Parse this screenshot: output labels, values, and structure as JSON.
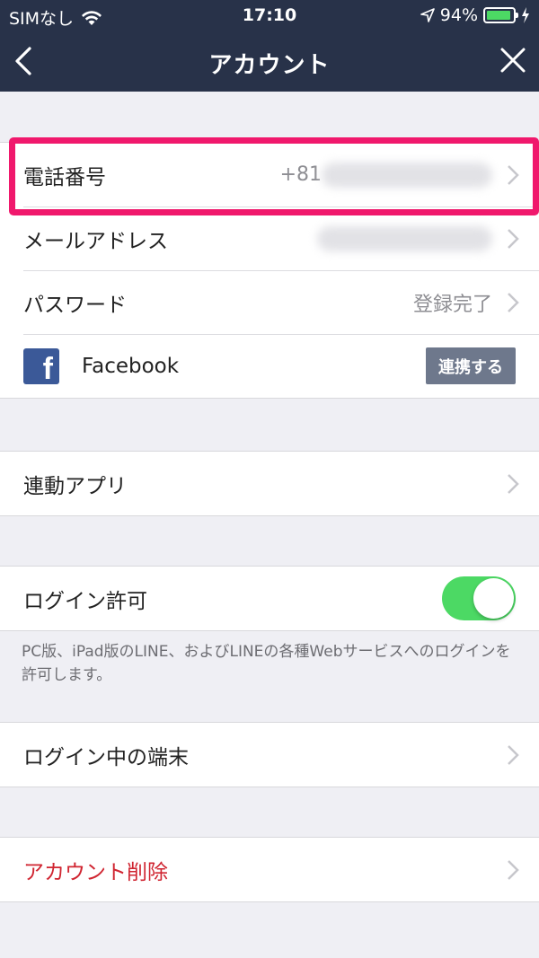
{
  "status_bar": {
    "carrier": "SIMなし",
    "time": "17:10",
    "battery": "94%",
    "battery_level": 0.94,
    "battery_color": "#4cd964"
  },
  "nav": {
    "title": "アカウント",
    "back_icon": "chevron-left-icon",
    "close_icon": "close-icon"
  },
  "account": {
    "phone_label": "電話番号",
    "phone_value": "+81",
    "email_label": "メールアドレス",
    "password_label": "パスワード",
    "password_value": "登録完了",
    "facebook_label": "Facebook",
    "facebook_button": "連携する"
  },
  "apps": {
    "linked_apps_label": "連動アプリ"
  },
  "login": {
    "allow_label": "ログイン許可",
    "allow_enabled": true,
    "note": "PC版、iPad版のLINE、およびLINEの各種Webサービスへのログインを許可します。"
  },
  "devices": {
    "logged_in_devices_label": "ログイン中の端末"
  },
  "delete": {
    "delete_account_label": "アカウント削除"
  },
  "colors": {
    "header_bg": "#283249",
    "highlight": "#f0186c",
    "toggle_on": "#4cd964",
    "danger": "#d02531",
    "facebook_blue": "#3b5998"
  }
}
